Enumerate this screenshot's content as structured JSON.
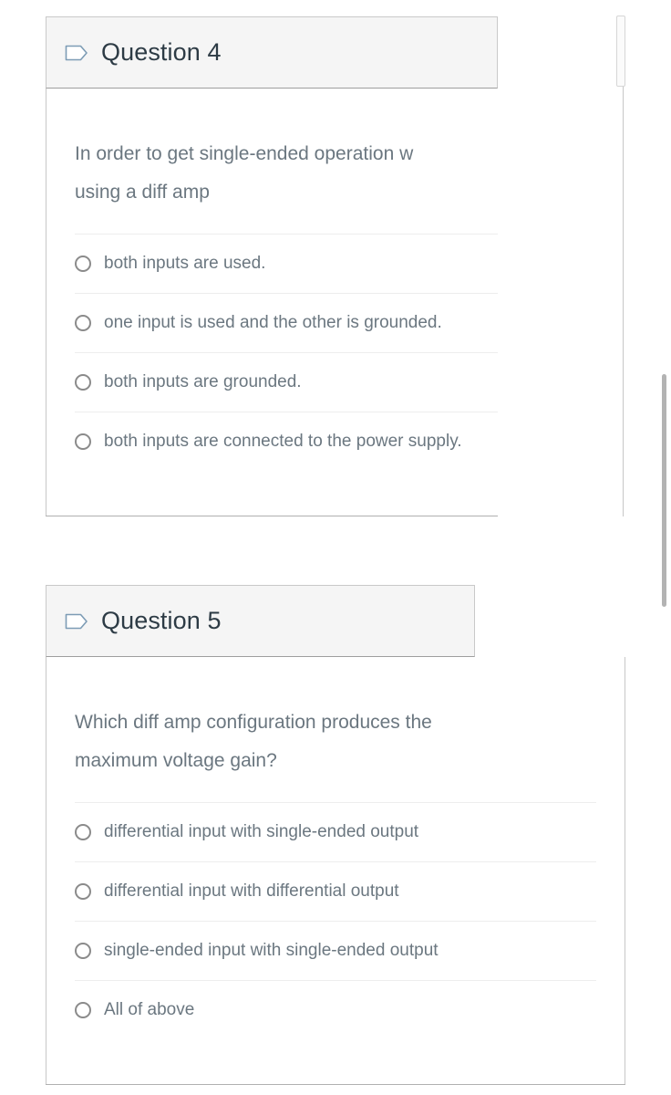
{
  "page": {
    "background": "#ffffff",
    "text_color": "#6b7780",
    "title_color": "#2d3b45",
    "header_background": "#f5f5f5",
    "border_color": "#c9c9c9",
    "separator_color": "#ededed",
    "radio_color": "#8b8b8b",
    "flag_icon_color": "#7d9cb5",
    "scrollbar_color": "#b3b3b3"
  },
  "questions": [
    {
      "id": "question-4",
      "header_label": "Question 4",
      "flag_icon": "flag-tag-icon",
      "prompt_lines": [
        "In order to get single-ended operation w",
        "using a diff amp"
      ],
      "answers": [
        {
          "label": "both inputs are used.",
          "selected": false
        },
        {
          "label": "one input is used and the other is grounded.",
          "selected": false
        },
        {
          "label": "both inputs are grounded.",
          "selected": false
        },
        {
          "label": "both inputs are connected to the power supply.",
          "selected": false
        }
      ]
    },
    {
      "id": "question-5",
      "header_label": "Question 5",
      "flag_icon": "flag-tag-icon",
      "prompt_lines": [
        "Which diff amp configuration produces the",
        "maximum voltage gain?"
      ],
      "answers": [
        {
          "label": "differential input with single-ended output",
          "selected": false
        },
        {
          "label": "differential input with differential output",
          "selected": false
        },
        {
          "label": "single-ended input with single-ended output",
          "selected": false
        },
        {
          "label": "All of above",
          "selected": false
        }
      ]
    }
  ],
  "scrollbars": {
    "page_scrollbar_label": "page-scrollbar",
    "inner_scrollbar_label": "inner-scrollbar"
  }
}
